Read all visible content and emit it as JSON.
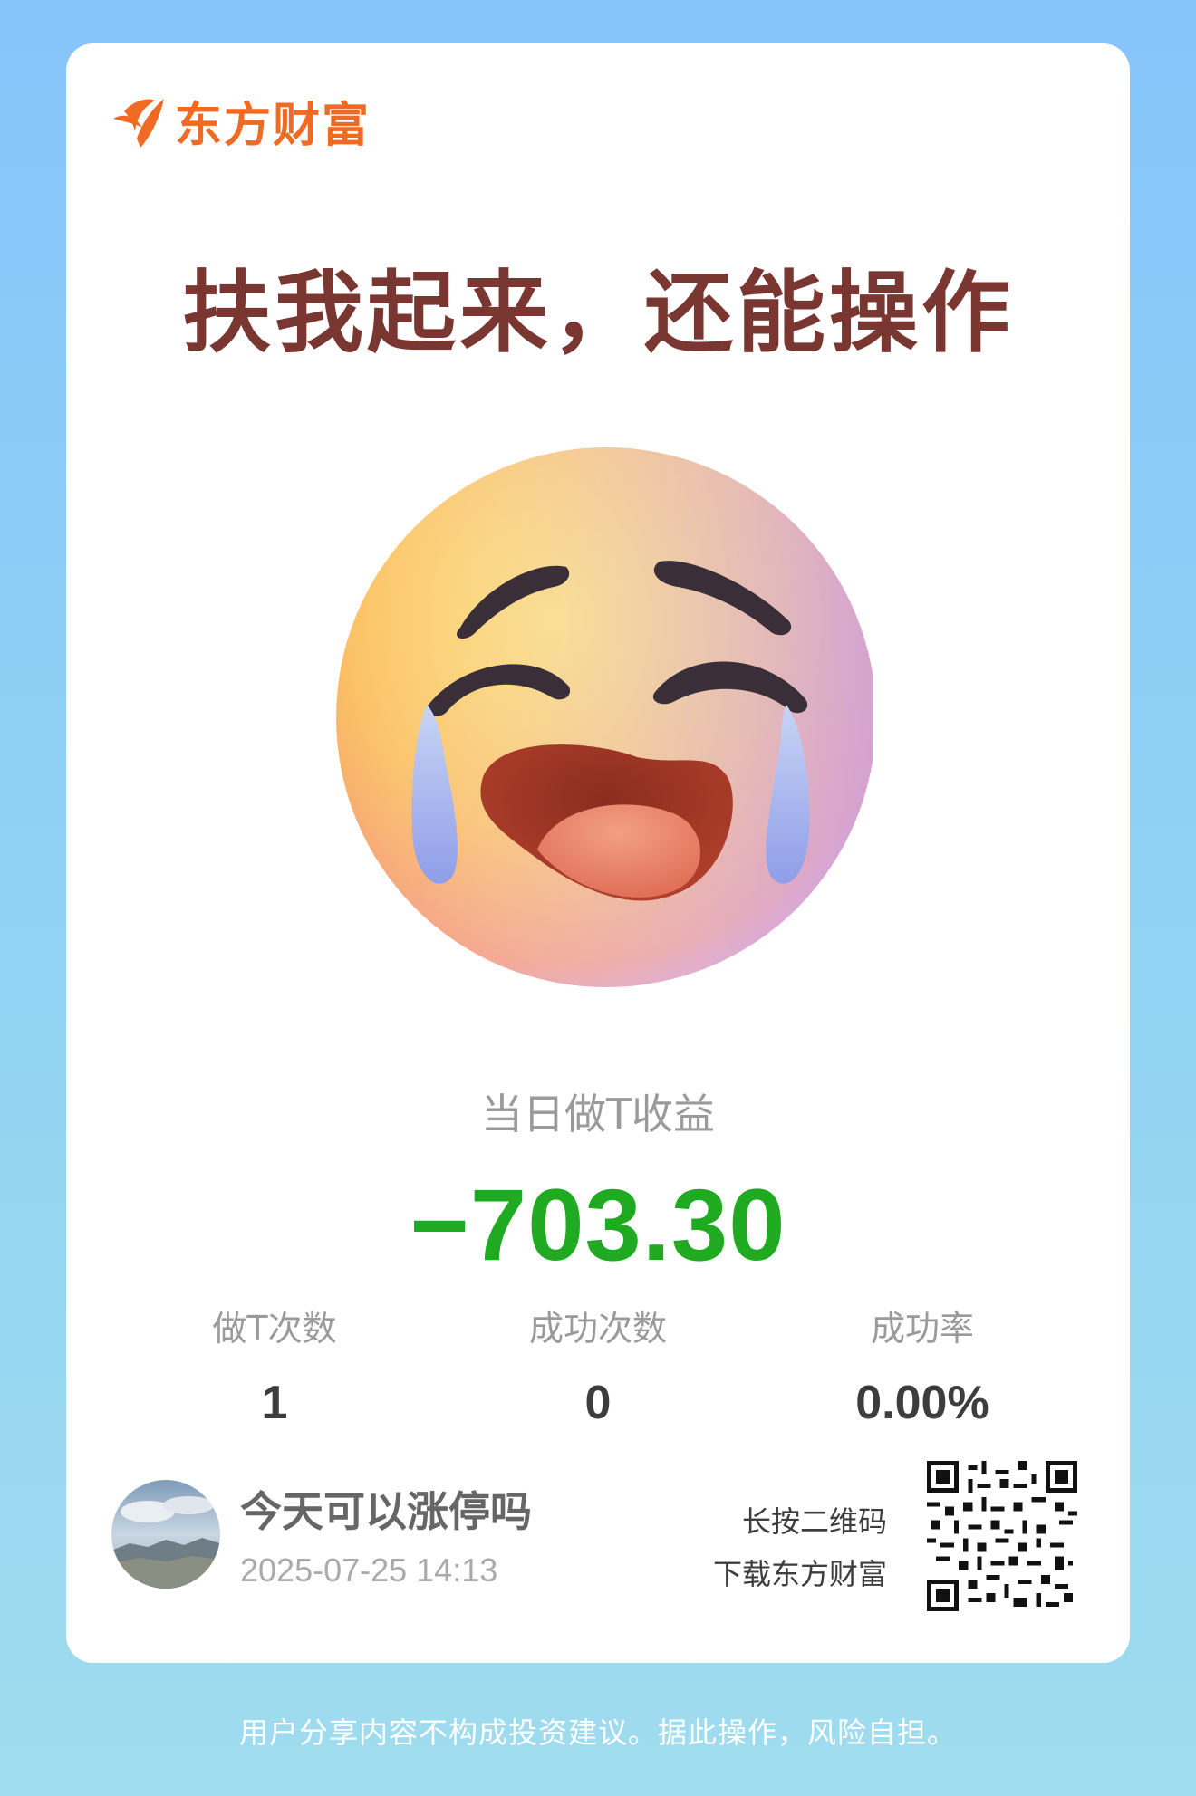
{
  "brand": {
    "name": "东方财富",
    "color": "#ef6a23"
  },
  "headline": "扶我起来，还能操作",
  "icon": {
    "emoji": "loudly-crying-face-icon"
  },
  "profit": {
    "label": "当日做T收益",
    "value": "−703.30",
    "color": "#1faa22"
  },
  "stats": [
    {
      "label": "做T次数",
      "value": "1"
    },
    {
      "label": "成功次数",
      "value": "0"
    },
    {
      "label": "成功率",
      "value": "0.00%"
    }
  ],
  "user": {
    "name": "今天可以涨停吗",
    "datetime": "2025-07-25 14:13"
  },
  "qr": {
    "line1": "长按二维码",
    "line2": "下载东方财富"
  },
  "disclaimer": "用户分享内容不构成投资建议。据此操作，风险自担。"
}
